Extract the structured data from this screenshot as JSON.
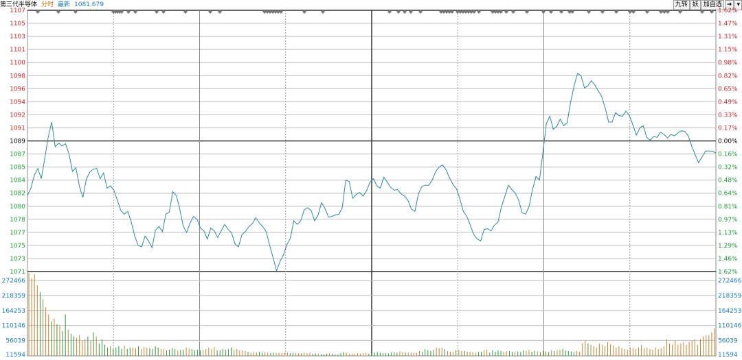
{
  "header": {
    "name": "第三代半导体",
    "mode": "分时",
    "latest_label": "最新",
    "latest_value": "1081.679"
  },
  "toolbar": {
    "btn1": "九转",
    "btn2": "妖",
    "btn3": "加自选",
    "btn4": "➜",
    "btn5": "▾"
  },
  "colors": {
    "up": "#d0242b",
    "down": "#1f9a36",
    "line": "#2b8a9a",
    "grid": "#bcbcbc",
    "volume_axis": "#1a7ab8",
    "volume_up": "#c8822e",
    "volume_down": "#2e9a3a"
  },
  "chart_data": {
    "type": "line",
    "base_price": 1089,
    "ylim": [
      1071,
      1107
    ],
    "price_ticks": [
      "1107",
      "1105",
      "1103",
      "1101",
      "1100",
      "1098",
      "1096",
      "1094",
      "1092",
      "1091",
      "1089",
      "1087",
      "1085",
      "1084",
      "1082",
      "1080",
      "1078",
      "1077",
      "1075",
      "1073",
      "1071"
    ],
    "pct_ticks": [
      "1.62%",
      "1.47%",
      "1.31%",
      "1.15%",
      "0.98%",
      "0.82%",
      "0.65%",
      "0.49%",
      "0.33%",
      "0.17%",
      "0.00%",
      "0.16%",
      "0.32%",
      "0.48%",
      "0.64%",
      "0.81%",
      "0.97%",
      "1.13%",
      "1.29%",
      "1.46%",
      "1.62%"
    ],
    "volume_ticks": [
      "272466",
      "218359",
      "164253",
      "110146",
      "56039",
      "11594"
    ],
    "volume_ylim": [
      0,
      300000
    ],
    "price_series": [
      1081.5,
      1082.5,
      1084.3,
      1085.2,
      1083.8,
      1086.6,
      1089.5,
      1091.6,
      1088.2,
      1088.7,
      1088.3,
      1088.6,
      1087.2,
      1084.8,
      1085.3,
      1082.8,
      1081.2,
      1083.7,
      1084.7,
      1085.1,
      1085.2,
      1083.8,
      1084.6,
      1082.5,
      1082.8,
      1082.2,
      1080.8,
      1079.4,
      1078.9,
      1079.3,
      1077.8,
      1075.9,
      1074.6,
      1074.4,
      1075.9,
      1075.2,
      1074.3,
      1076.7,
      1077.2,
      1076.5,
      1078.9,
      1079.2,
      1082.0,
      1081.5,
      1079.7,
      1077.3,
      1076.4,
      1077.7,
      1078.6,
      1078.2,
      1077.0,
      1076.6,
      1075.5,
      1077.0,
      1076.6,
      1075.7,
      1076.6,
      1077.5,
      1076.8,
      1076.3,
      1074.8,
      1074.4,
      1076.1,
      1076.5,
      1077.2,
      1077.6,
      1078.4,
      1077.7,
      1077.2,
      1076.5,
      1074.6,
      1072.9,
      1071.1,
      1072.4,
      1073.3,
      1074.7,
      1075.6,
      1078.0,
      1077.5,
      1078.0,
      1079.5,
      1079.8,
      1079.4,
      1078.0,
      1078.8,
      1080.5,
      1079.7,
      1078.5,
      1078.6,
      1078.8,
      1078.9,
      1079.8,
      1083.6,
      1083.4,
      1081.1,
      1081.6,
      1081.9,
      1081.4,
      1082.1,
      1083.3,
      1083.8,
      1082.8,
      1082.5,
      1084.0,
      1083.3,
      1082.6,
      1082.2,
      1082.3,
      1081.7,
      1081.4,
      1080.8,
      1079.6,
      1079.3,
      1081.7,
      1082.7,
      1082.9,
      1082.9,
      1083.6,
      1084.8,
      1085.4,
      1085.7,
      1085.0,
      1083.9,
      1083.0,
      1082.4,
      1081.0,
      1079.3,
      1078.6,
      1077.4,
      1076.1,
      1075.5,
      1075.2,
      1076.8,
      1076.9,
      1076.6,
      1077.4,
      1077.8,
      1079.9,
      1081.4,
      1082.9,
      1082.3,
      1081.8,
      1080.8,
      1079.1,
      1078.9,
      1080.0,
      1082.3,
      1084.1,
      1083.6,
      1087.4,
      1091.4,
      1092.4,
      1090.6,
      1091.0,
      1092.0,
      1091.1,
      1091.5,
      1094.3,
      1096.6,
      1098.3,
      1098.0,
      1096.3,
      1096.6,
      1097.3,
      1096.7,
      1095.9,
      1095.1,
      1093.5,
      1091.6,
      1091.6,
      1092.9,
      1092.5,
      1092.4,
      1093.1,
      1092.5,
      1091.2,
      1089.8,
      1090.8,
      1091.1,
      1089.5,
      1089.1,
      1089.6,
      1089.5,
      1090.2,
      1089.9,
      1089.4,
      1089.9,
      1089.7,
      1090.1,
      1090.4,
      1090.3,
      1089.7,
      1088.3,
      1087.1,
      1086.0,
      1086.8,
      1087.6,
      1087.6,
      1087.6,
      1087.3
    ],
    "volume_series": [
      300000,
      280000,
      295000,
      255000,
      230000,
      205000,
      175000,
      150000,
      125000,
      135000,
      115000,
      110000,
      90000,
      150000,
      95000,
      80000,
      70000,
      65000,
      75000,
      55000,
      60000,
      70000,
      55000,
      85000,
      70000,
      45000,
      60000,
      40000,
      30000,
      35000,
      25000,
      30000,
      35000,
      25000,
      38000,
      25000,
      30000,
      30000,
      28000,
      35000,
      25000,
      32000,
      30000,
      28000,
      25000,
      35000,
      30000,
      25000,
      25000,
      20000,
      22000,
      28000,
      25000,
      20000,
      22000,
      22000,
      30000,
      28000,
      25000,
      20000,
      22000,
      20000,
      20000,
      25000,
      30000,
      25000,
      32000,
      20000,
      20000,
      25000,
      22000,
      25000,
      30000,
      22000,
      25000,
      20000,
      20000,
      18000,
      15000,
      12000,
      14000,
      12000,
      15000,
      12000,
      14000,
      12000,
      10000,
      12000,
      10000,
      12000,
      10000,
      12000,
      13000,
      10000,
      12000,
      11000,
      10000,
      10000,
      12000,
      10000,
      12000,
      8000,
      9000,
      8000,
      7000,
      6000,
      8000,
      10000,
      8000,
      6000,
      5000,
      10000,
      14000,
      12000,
      8000,
      9000,
      8000,
      10000,
      8000,
      10000,
      12000,
      8000,
      9000,
      12000,
      14000,
      12000,
      10000,
      10000,
      8000,
      12000,
      14000,
      12000,
      16000,
      14000,
      12000,
      12000,
      13000,
      12000,
      10000,
      18000,
      15000,
      25000,
      20000,
      18000,
      22000,
      30000,
      28000,
      30000,
      25000,
      18000,
      15000,
      14000,
      20000,
      22000,
      18000,
      18000,
      15000,
      15000,
      14000,
      12000,
      14000,
      15000,
      20000,
      22000,
      12000,
      20000,
      15000,
      20000,
      18000,
      15000,
      16000,
      18000,
      15000,
      14000,
      16000,
      14000,
      20000,
      18000,
      22000,
      15000,
      18000,
      16000,
      14000,
      18000,
      16000,
      14000,
      20000,
      18000,
      20000,
      22000,
      25000,
      20000,
      18000,
      16000,
      14000,
      18000,
      15000,
      45000,
      55000,
      45000,
      40000,
      35000,
      30000,
      45000,
      40000,
      35000,
      50000,
      42000,
      38000,
      30000,
      35000,
      28000,
      25000,
      22000,
      30000,
      28000,
      25000,
      30000,
      40000,
      28000,
      30000,
      25000,
      22000,
      30000,
      25000,
      28000,
      35000,
      60000,
      45000,
      40000,
      55000,
      40000,
      45000,
      50000,
      40000,
      50000,
      55000,
      60000,
      40000,
      60000,
      70000,
      75000,
      75000,
      85000,
      100000
    ],
    "grid": true,
    "markers_row": "top"
  }
}
